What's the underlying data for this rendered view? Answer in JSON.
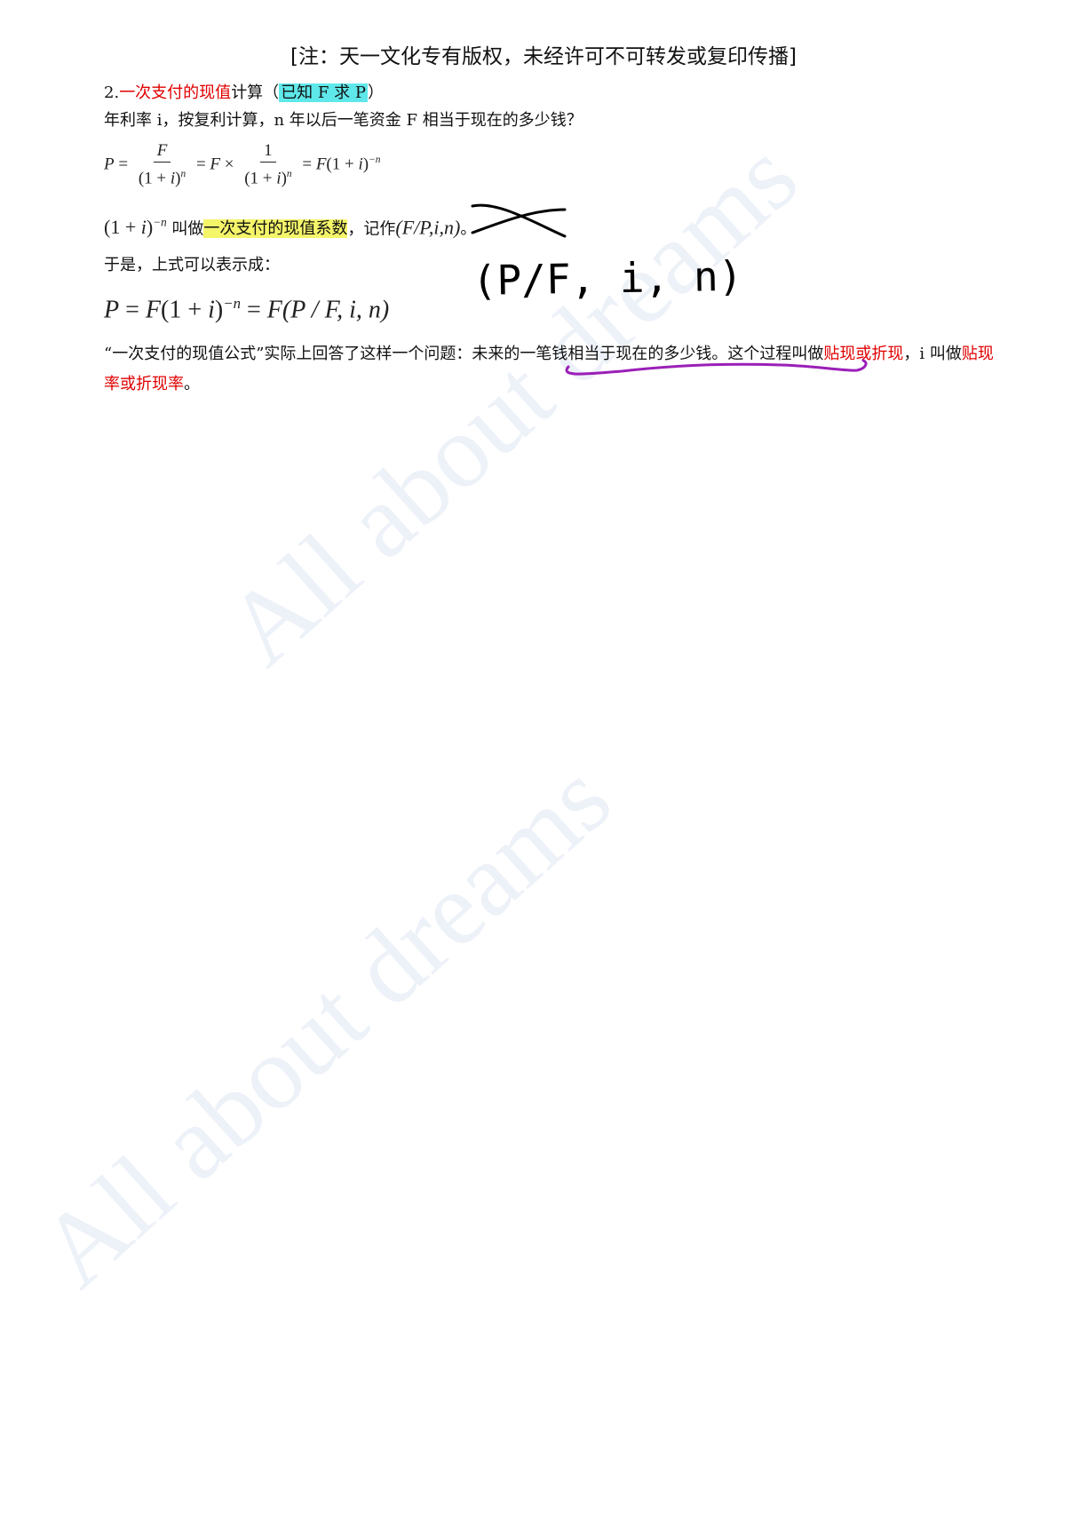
{
  "header_note": "[注：天一文化专有版权，未经许可不可转发或复印传播]",
  "section": {
    "number": "2.",
    "title_red": "一次支付的现值",
    "title_rest": "计算（",
    "known": "已知 F 求 P",
    "close_paren": "）"
  },
  "question_line": "年利率 i，按复利计算，n 年以后一笔资金 F 相当于现在的多少钱？",
  "formula1": {
    "p": "P",
    "eq": " = ",
    "f": "F",
    "den_open": "(1 + ",
    "den_i": "i",
    "den_close": ")",
    "n": "n",
    "times": " × ",
    "one": "1",
    "tail_open": "(1 + ",
    "tail_i": "i",
    "tail_close": ")",
    "neg_n": "−n"
  },
  "factor_line": {
    "expr_open": "(1 + ",
    "expr_i": "i",
    "expr_close": ")",
    "exp": "−n",
    "text1": " 叫做",
    "highlight": "一次支付的现值系数",
    "text2": "，记作",
    "crossed": "(F/P,i,n)",
    "period": "。"
  },
  "so_line": "于是，上式可以表示成：",
  "formula2": {
    "p": "P",
    "eq": " = ",
    "f": "F",
    "open": "(1 + ",
    "i": "i",
    "close": ")",
    "exp": "−n",
    "eq2": " = ",
    "notation": "(P / F, i, n)"
  },
  "handwritten_correction": "(P/F, i, n)",
  "paragraph": {
    "part1": "“一次支付的现值公式”实际上回答了这样一个问题：",
    "underlined": "未来的一笔钱相当于现在的多少钱",
    "part2": "。这个过程叫做",
    "red1a": "贴",
    "red1b": "现或折现",
    "part3": "，i 叫做",
    "red2": "贴现率或折现率",
    "part4": "。"
  },
  "watermark": "All about dreams",
  "colors": {
    "red": "#e00000",
    "cyan_highlight": "#5fe8ea",
    "yellow_highlight": "#f5f56a",
    "purple_ink": "#9b1fb8",
    "black_ink": "#000000"
  }
}
